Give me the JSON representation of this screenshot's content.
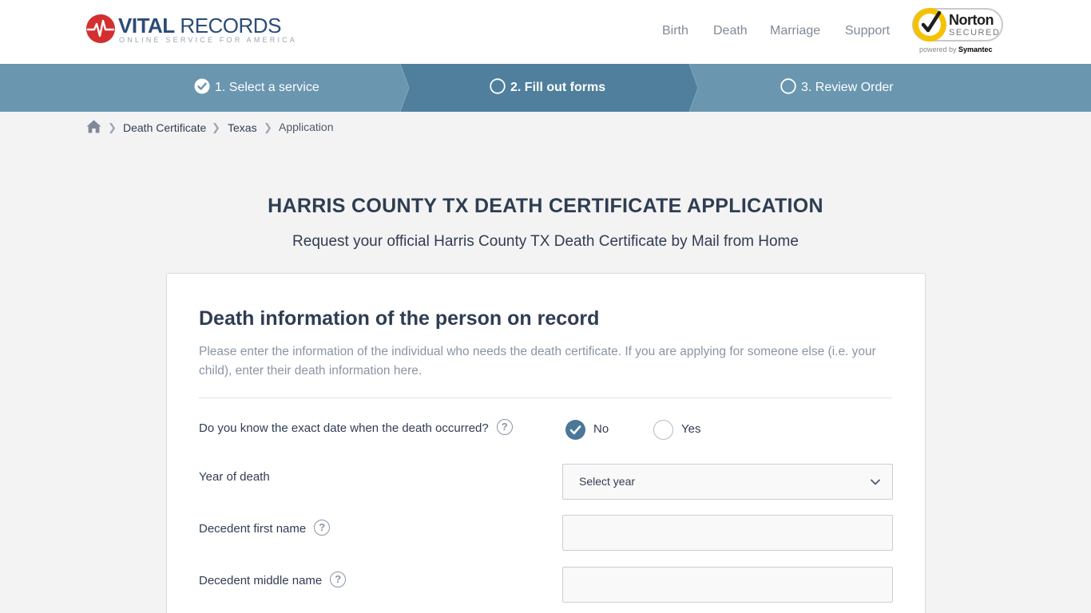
{
  "header": {
    "logo_title_bold": "VITAL",
    "logo_title_light": " RECORDS",
    "logo_subtitle": "ONLINE SERVICE FOR AMERICA",
    "nav": [
      "Birth",
      "Death",
      "Marriage",
      "Support"
    ],
    "badge": {
      "name": "Norton",
      "secured": "SECURED",
      "powered_prefix": "powered by ",
      "powered_brand": "Symantec"
    }
  },
  "steps": [
    {
      "label": "1. Select a service",
      "state": "done"
    },
    {
      "label": "2. Fill out forms",
      "state": "active"
    },
    {
      "label": "3. Review Order",
      "state": "pending"
    }
  ],
  "breadcrumb": [
    "Death Certificate",
    "Texas",
    "Application"
  ],
  "page": {
    "title": "HARRIS COUNTY TX DEATH CERTIFICATE APPLICATION",
    "subtitle": "Request your official Harris County TX Death Certificate by Mail from Home"
  },
  "form": {
    "section_title": "Death information of the person on record",
    "section_desc": "Please enter the information of the individual who needs the death certificate. If you are applying for someone else (i.e. your child), enter their death information here.",
    "exact_date_question": "Do you know the exact date when the death occurred?",
    "exact_date_options": [
      "No",
      "Yes"
    ],
    "exact_date_selected": "No",
    "year_label": "Year of death",
    "year_placeholder": "Select year",
    "first_name_label": "Decedent first name",
    "first_name_value": "",
    "middle_name_label": "Decedent middle name",
    "middle_name_value": ""
  },
  "colors": {
    "brand_blue": "#2b4b78",
    "brand_red": "#d32f2f",
    "steps_bg": "#6a96b0",
    "steps_active": "#4f7f9c",
    "radio_on": "#4a7896",
    "norton_yellow": "#f6c200"
  },
  "icons": {
    "home": "home-icon",
    "breadcrumb_sep": "chevron-right-icon",
    "help": "question-circle-icon",
    "select": "chevron-down-icon"
  }
}
